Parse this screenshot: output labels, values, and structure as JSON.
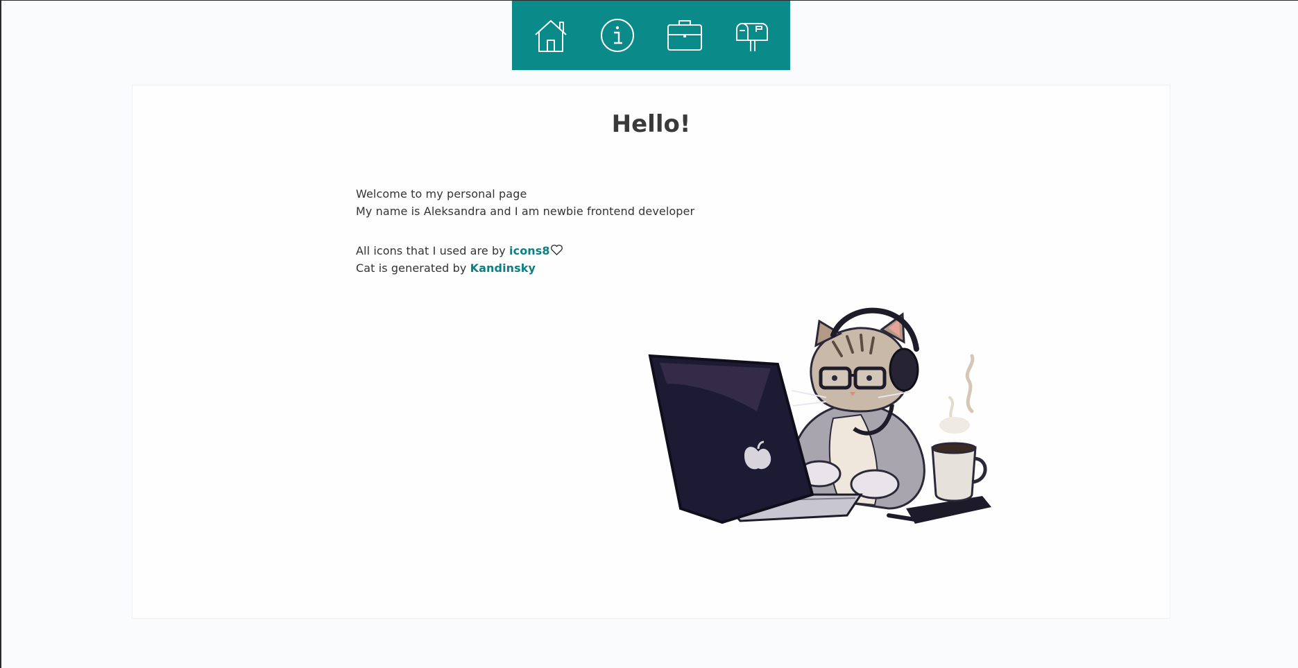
{
  "nav": {
    "items": [
      {
        "icon": "home-icon",
        "label": "Home"
      },
      {
        "icon": "info-icon",
        "label": "About"
      },
      {
        "icon": "briefcase-icon",
        "label": "Portfolio"
      },
      {
        "icon": "mailbox-icon",
        "label": "Contact"
      }
    ],
    "background": "#0b8a8a"
  },
  "main": {
    "title": "Hello!",
    "intro_line1": "Welcome to my personal page",
    "intro_line2": "My name is Aleksandra and I am newbie frontend developer",
    "credits_icons_prefix": "All icons that I used are by ",
    "credits_icons_link": "icons8",
    "credits_cat_prefix": "Cat is generated by ",
    "credits_cat_link": "Kandinsky"
  },
  "colors": {
    "accent": "#0b8a8a",
    "link": "#0b7f86",
    "text": "#333333"
  }
}
